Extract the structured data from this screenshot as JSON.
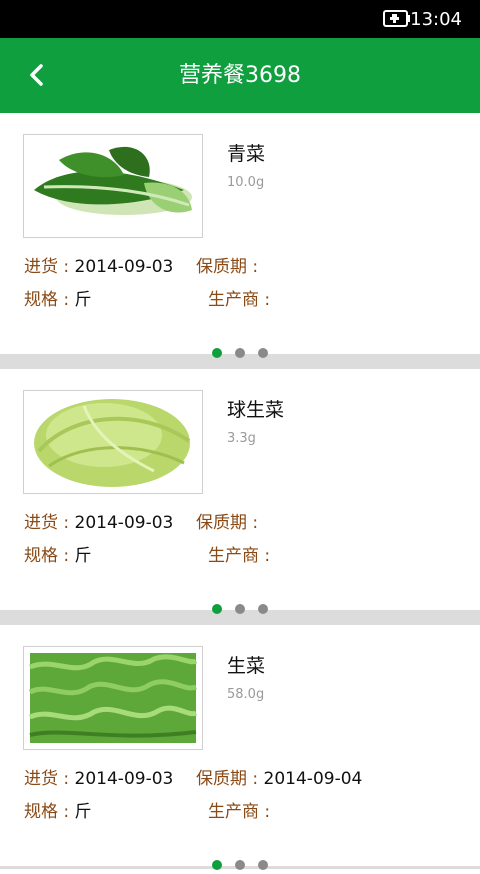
{
  "status_bar": {
    "time": "13:04",
    "battery_icon": "battery-charging-icon"
  },
  "app_bar": {
    "title": "营养餐3698",
    "back_icon": "back-arrow-icon"
  },
  "labels": {
    "purchase": "进货 :",
    "shelf_life": "保质期 :",
    "spec": "规格 :",
    "manufacturer": "生产商 :"
  },
  "colors": {
    "primary": "#109f3f",
    "label": "#8a4a16",
    "weight": "#9a9a9a"
  },
  "items": [
    {
      "name": "青菜",
      "weight": "10.0g",
      "purchase_date": "2014-09-03",
      "shelf_life": "",
      "spec": "斤",
      "manufacturer": "",
      "image": "bok-choy"
    },
    {
      "name": "球生菜",
      "weight": "3.3g",
      "purchase_date": "2014-09-03",
      "shelf_life": "",
      "spec": "斤",
      "manufacturer": "",
      "image": "iceberg-lettuce"
    },
    {
      "name": "生菜",
      "weight": "58.0g",
      "purchase_date": "2014-09-03",
      "shelf_life": "2014-09-04",
      "spec": "斤",
      "manufacturer": "",
      "image": "leaf-lettuce"
    }
  ]
}
